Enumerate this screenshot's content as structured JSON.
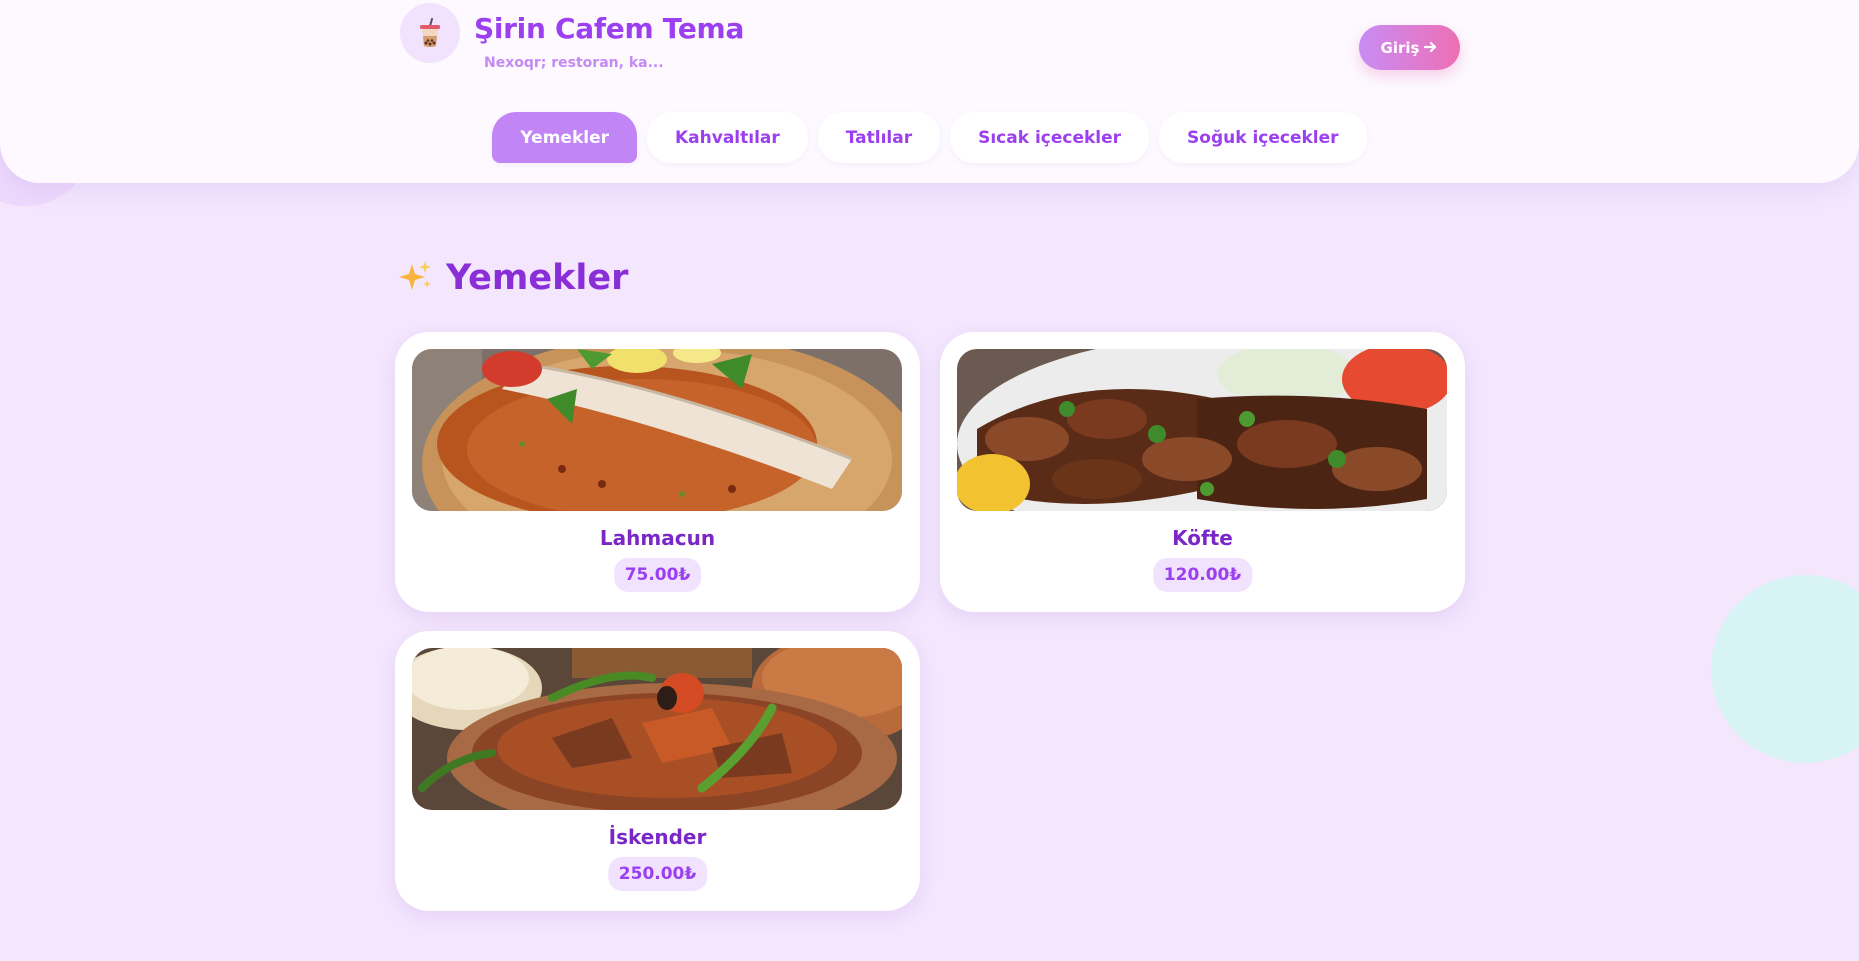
{
  "header": {
    "title": "Şirin Cafem Tema",
    "subtitle": "Nexoqr; restoran, ka...",
    "logo_icon": "bubble-tea-icon",
    "login_label": "Giriş",
    "login_icon": "arrow-right-icon"
  },
  "nav": {
    "tabs": [
      {
        "label": "Yemekler",
        "active": true
      },
      {
        "label": "Kahvaltılar",
        "active": false
      },
      {
        "label": "Tatlılar",
        "active": false
      },
      {
        "label": "Sıcak içecekler",
        "active": false
      },
      {
        "label": "Soğuk içecekler",
        "active": false
      }
    ]
  },
  "section": {
    "title": "Yemekler",
    "icon": "sparkles-icon"
  },
  "items": [
    {
      "name": "Lahmacun",
      "price": "75.00₺"
    },
    {
      "name": "Köfte",
      "price": "120.00₺"
    },
    {
      "name": "İskender",
      "price": "250.00₺"
    }
  ],
  "colors": {
    "background": "#f3e6fd",
    "accent": "#9b3ff0",
    "active_tab": "#c185f6",
    "login_gradient_start": "#c88cf4",
    "login_gradient_end": "#ee6fb4"
  }
}
